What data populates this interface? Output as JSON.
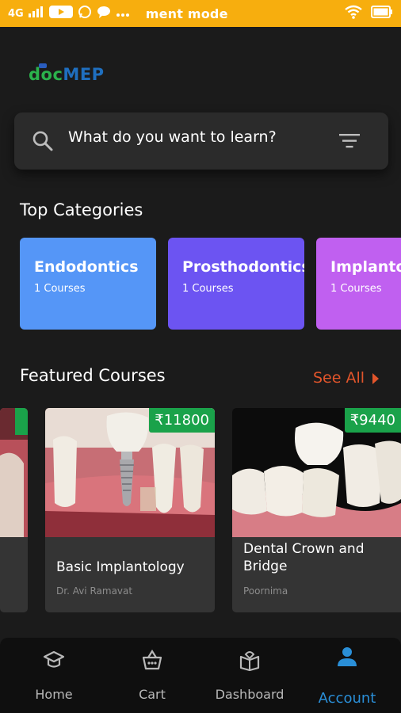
{
  "status_bar": {
    "network": "4G",
    "icons": [
      "signal-icon",
      "youtube-icon",
      "whatsapp-icon",
      "chat-icon",
      "more-icon"
    ],
    "notification_text": "ment mode",
    "right_icons": [
      "wifi-icon",
      "battery-icon"
    ],
    "color": "#f7ae0e"
  },
  "logo": {
    "part1": "doc",
    "part2": "MEP"
  },
  "search": {
    "placeholder": "What do you want to learn?"
  },
  "categories": {
    "title": "Top Categories",
    "items": [
      {
        "name": "Endodontics",
        "count": "1 Courses",
        "color": "#5596f7"
      },
      {
        "name": "Prosthodontics",
        "count": "1 Courses",
        "color": "#6c54f2"
      },
      {
        "name": "Implantology",
        "count": "1 Courses",
        "color": "#c060f0"
      }
    ]
  },
  "featured": {
    "title": "Featured Courses",
    "see_all": "See All",
    "courses": [
      {
        "title": "Basic Implantology",
        "author": "Dr. Avi Ramavat",
        "price": "₹11800"
      },
      {
        "title": "Dental Crown and Bridge",
        "author": "Poornima",
        "price": "₹9440"
      }
    ]
  },
  "bottom_nav": {
    "items": [
      {
        "label": "Home",
        "icon": "graduation-cap-icon"
      },
      {
        "label": "Cart",
        "icon": "basket-icon"
      },
      {
        "label": "Dashboard",
        "icon": "book-icon"
      },
      {
        "label": "Account",
        "icon": "person-icon",
        "active": true
      }
    ],
    "active_color": "#2a8fd8"
  }
}
